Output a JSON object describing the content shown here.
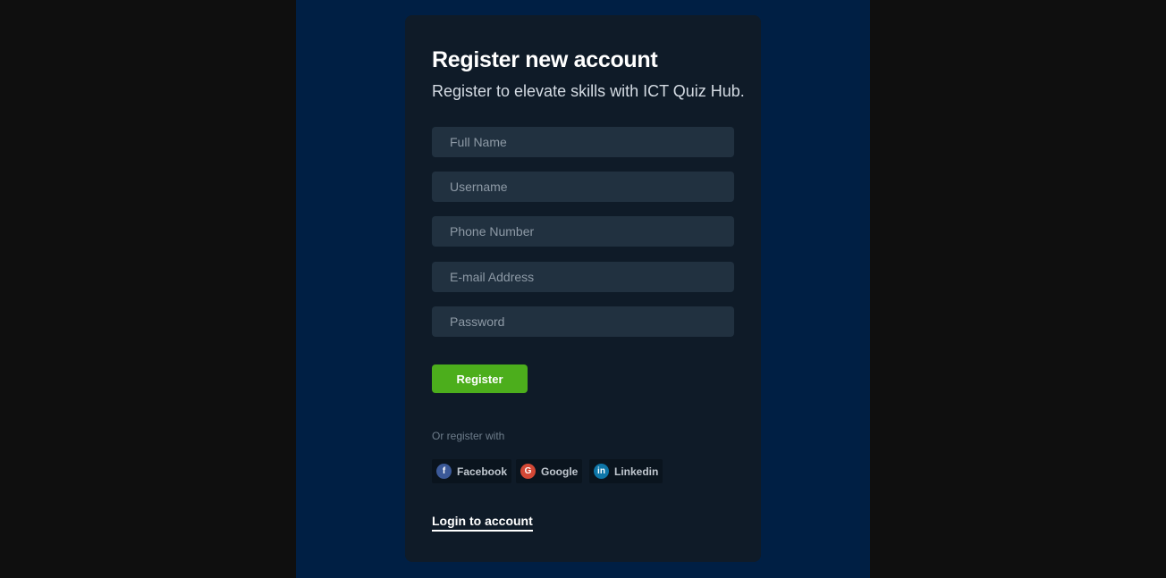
{
  "form": {
    "title": "Register new account",
    "subtitle": "Register to elevate skills with ICT Quiz Hub.",
    "fields": {
      "full_name": {
        "placeholder": "Full Name",
        "value": ""
      },
      "username": {
        "placeholder": "Username",
        "value": ""
      },
      "phone": {
        "placeholder": "Phone Number",
        "value": ""
      },
      "email": {
        "placeholder": "E-mail Address",
        "value": ""
      },
      "password": {
        "placeholder": "Password",
        "value": ""
      }
    },
    "register_label": "Register",
    "or_register_with": "Or register with",
    "social": [
      {
        "label": "Facebook",
        "icon": "facebook-icon",
        "glyph": "f",
        "color": "#3b5998"
      },
      {
        "label": "Google",
        "icon": "google-icon",
        "glyph": "G",
        "color": "#d34836"
      },
      {
        "label": "Linkedin",
        "icon": "linkedin-icon",
        "glyph": "in",
        "color": "#0e76a8"
      }
    ],
    "login_link": "Login to account"
  },
  "colors": {
    "page_bg": "#0f0f0f",
    "stage_bg": "#001f44",
    "card_bg": "#0f1b28",
    "field_bg": "#213140",
    "accent": "#4cae1c"
  }
}
